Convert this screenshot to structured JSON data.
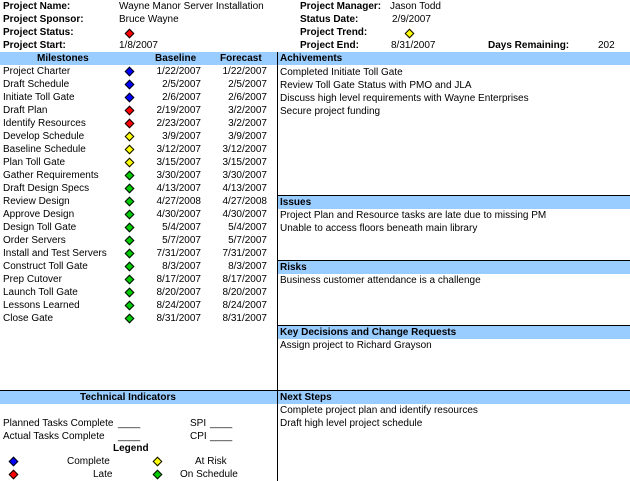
{
  "header": {
    "project_name_label": "Project Name:",
    "project_name": "Wayne Manor Server Installation",
    "project_sponsor_label": "Project Sponsor:",
    "project_sponsor": "Bruce Wayne",
    "project_status_label": "Project Status:",
    "project_status_color": "#ff0000",
    "project_start_label": "Project Start:",
    "project_start": "1/8/2007",
    "project_manager_label": "Project Manager:",
    "project_manager": "Jason Todd",
    "status_date_label": "Status Date:",
    "status_date": "2/9/2007",
    "project_trend_label": "Project Trend:",
    "project_trend_color": "#ffff00",
    "project_end_label": "Project End:",
    "project_end": "8/31/2007",
    "days_remaining_label": "Days Remaining:",
    "days_remaining": "202"
  },
  "milestones": {
    "header": "Milestones",
    "baseline_header": "Baseline",
    "forecast_header": "Forecast",
    "rows": [
      {
        "name": "Project Charter",
        "color": "#0000ff",
        "baseline": "1/22/2007",
        "forecast": "1/22/2007"
      },
      {
        "name": "Draft Schedule",
        "color": "#0000ff",
        "baseline": "2/5/2007",
        "forecast": "2/5/2007"
      },
      {
        "name": "Initiate Toll Gate",
        "color": "#0000ff",
        "baseline": "2/6/2007",
        "forecast": "2/6/2007"
      },
      {
        "name": "Draft Plan",
        "color": "#ff0000",
        "baseline": "2/19/2007",
        "forecast": "3/2/2007"
      },
      {
        "name": "Identify Resources",
        "color": "#ff0000",
        "baseline": "2/23/2007",
        "forecast": "3/2/2007"
      },
      {
        "name": "Develop Schedule",
        "color": "#ffff00",
        "baseline": "3/9/2007",
        "forecast": "3/9/2007"
      },
      {
        "name": "Baseline Schedule",
        "color": "#ffff00",
        "baseline": "3/12/2007",
        "forecast": "3/12/2007"
      },
      {
        "name": "Plan Toll Gate",
        "color": "#ffff00",
        "baseline": "3/15/2007",
        "forecast": "3/15/2007"
      },
      {
        "name": "Gather Requirements",
        "color": "#00cc00",
        "baseline": "3/30/2007",
        "forecast": "3/30/2007"
      },
      {
        "name": "Draft Design Specs",
        "color": "#00cc00",
        "baseline": "4/13/2007",
        "forecast": "4/13/2007"
      },
      {
        "name": "Review Design",
        "color": "#00cc00",
        "baseline": "4/27/2008",
        "forecast": "4/27/2008"
      },
      {
        "name": "Approve Design",
        "color": "#00cc00",
        "baseline": "4/30/2007",
        "forecast": "4/30/2007"
      },
      {
        "name": "Design Toll Gate",
        "color": "#00cc00",
        "baseline": "5/4/2007",
        "forecast": "5/4/2007"
      },
      {
        "name": "Order Servers",
        "color": "#00cc00",
        "baseline": "5/7/2007",
        "forecast": "5/7/2007"
      },
      {
        "name": "Install and Test Servers",
        "color": "#00cc00",
        "baseline": "7/31/2007",
        "forecast": "7/31/2007"
      },
      {
        "name": "Construct Toll Gate",
        "color": "#00cc00",
        "baseline": "8/3/2007",
        "forecast": "8/3/2007"
      },
      {
        "name": "Prep Cutover",
        "color": "#00cc00",
        "baseline": "8/17/2007",
        "forecast": "8/17/2007"
      },
      {
        "name": "Launch Toll Gate",
        "color": "#00cc00",
        "baseline": "8/20/2007",
        "forecast": "8/20/2007"
      },
      {
        "name": "Lessons Learned",
        "color": "#00cc00",
        "baseline": "8/24/2007",
        "forecast": "8/24/2007"
      },
      {
        "name": "Close Gate",
        "color": "#00cc00",
        "baseline": "8/31/2007",
        "forecast": "8/31/2007"
      }
    ]
  },
  "achievements": {
    "header": "Achivements",
    "items": [
      "Completed Initiate Toll Gate",
      "Review Toll Gate Status with PMO and JLA",
      "Discuss high level requirements with Wayne Enterprises",
      "Secure project funding"
    ]
  },
  "issues": {
    "header": "Issues",
    "items": [
      "Project Plan and Resource tasks are late due to missing PM",
      "Unable to access floors beneath main library"
    ]
  },
  "risks": {
    "header": "Risks",
    "items": [
      "Business customer attendance is a challenge"
    ]
  },
  "decisions": {
    "header": "Key Decisions and Change Requests",
    "items": [
      "Assign project to Richard Grayson"
    ]
  },
  "next_steps": {
    "header": "Next Steps",
    "items": [
      "Complete project plan and identify resources",
      "Draft high level project schedule"
    ]
  },
  "technical": {
    "header": "Technical Indicators",
    "planned_label": "Planned Tasks Complete",
    "planned_value": "____",
    "actual_label": "Actual Tasks Complete",
    "actual_value": "____",
    "spi_label": "SPI",
    "spi_value": "____",
    "cpi_label": "CPI",
    "cpi_value": "____"
  },
  "legend": {
    "title": "Legend",
    "complete_label": "Complete",
    "complete_color": "#0000ff",
    "at_risk_label": "At Risk",
    "at_risk_color": "#ffff00",
    "late_label": "Late",
    "late_color": "#ff0000",
    "on_schedule_label": "On Schedule",
    "on_schedule_color": "#00cc00"
  }
}
